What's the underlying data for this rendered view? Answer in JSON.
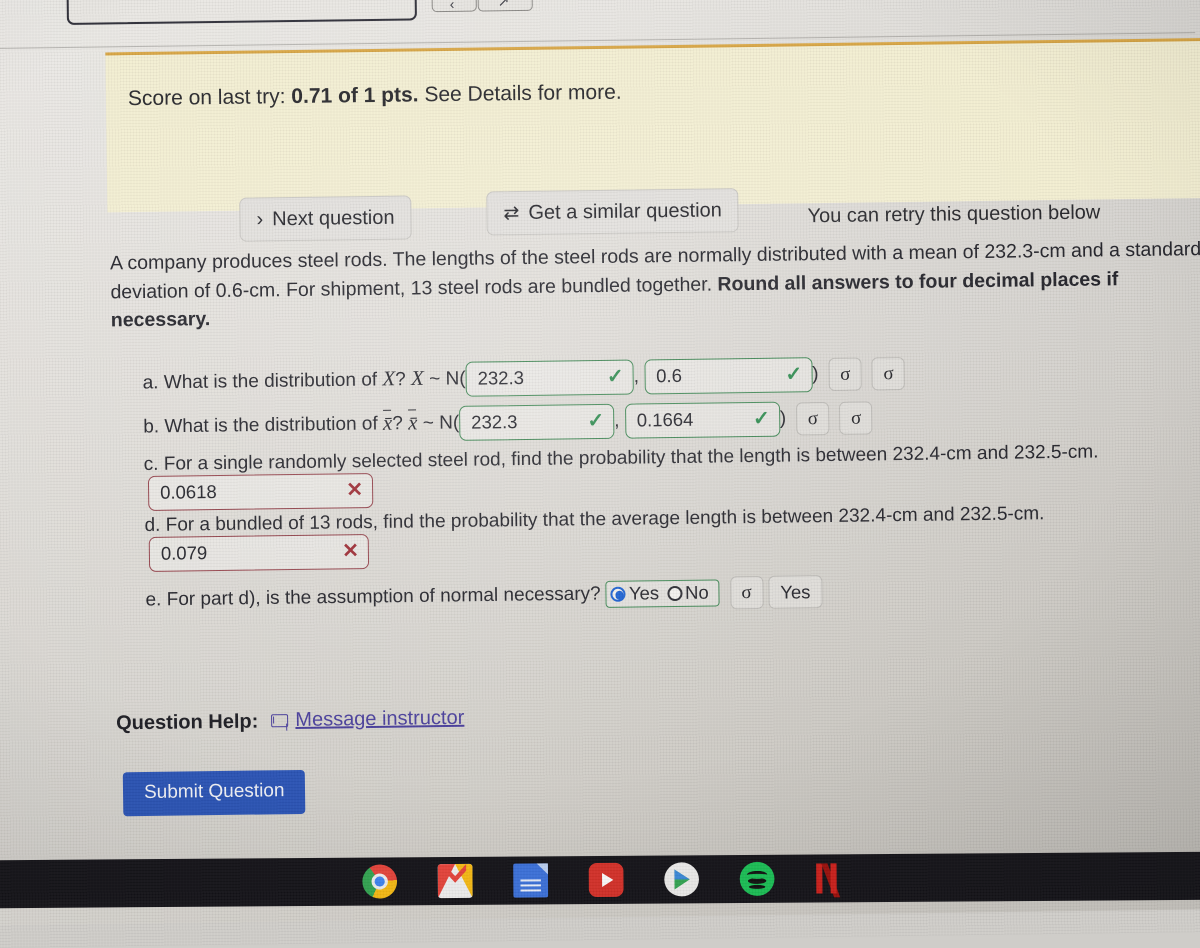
{
  "browser_chrome": {
    "tab_placeholder": "",
    "button_a_glyph": "‹",
    "button_b_glyph": "↗"
  },
  "alert": {
    "score_prefix": "Score on last try:",
    "score_value": "0.71 of 1 pts.",
    "score_suffix": "See Details for more.",
    "next_question_label": "Next question",
    "next_question_icon": "chevron-right-icon",
    "similar_question_label": "Get a similar question",
    "similar_question_icon": "refresh-swap-icon",
    "retry_note": "You can retry this question below",
    "background_color": "#f3eed2",
    "border_color": "#d8a544"
  },
  "question": {
    "prompt_part1": "A company produces steel rods. The lengths of the steel rods are normally distributed with a mean of 232.3-cm and a standard deviation of 0.6-cm. For shipment, 13 steel rods are bundled together. ",
    "prompt_bold": "Round all answers to four decimal places if necessary.",
    "mean": "232.3",
    "std_dev": "0.6",
    "bundle_size": "13",
    "parts": [
      {
        "letter": "a.",
        "text_before": "What is the distribution of",
        "variable": "X",
        "question_mark": "?",
        "dist_var": "X",
        "tilde": "~",
        "dist_open": "N(",
        "field1_value": "232.3",
        "field1_state": "correct",
        "field1_mark": "✓",
        "separator": ",",
        "field2_value": "0.6",
        "field2_state": "correct",
        "field2_mark": "✓",
        "dist_close": ")",
        "sigma_buttons": [
          "σ",
          "σ"
        ]
      },
      {
        "letter": "b.",
        "text_before": "What is the distribution of",
        "variable": "x̄",
        "question_mark": "?",
        "dist_var": "x̄",
        "tilde": "~",
        "dist_open": "N(",
        "field1_value": "232.3",
        "field1_state": "correct",
        "field1_mark": "✓",
        "separator": ",",
        "field2_value": "0.1664",
        "field2_state": "correct",
        "field2_mark": "✓",
        "dist_close": ")",
        "sigma_buttons": [
          "σ",
          "σ"
        ]
      },
      {
        "letter": "c.",
        "text": "For a single randomly selected steel rod, find the probability that the length is between 232.4-cm and 232.5-cm.",
        "field_value": "0.0618",
        "field_state": "incorrect",
        "field_mark": "✕"
      },
      {
        "letter": "d.",
        "text": "For a bundled of 13 rods, find the probability that the average length is between 232.4-cm and 232.5-cm.",
        "field_value": "0.079",
        "field_state": "incorrect",
        "field_mark": "✕"
      },
      {
        "letter": "e.",
        "text": "For part d), is the assumption of normal necessary?",
        "options": [
          "Yes",
          "No"
        ],
        "selected_option": "Yes",
        "sigma_button": "σ",
        "final_answer": "Yes"
      }
    ]
  },
  "footer": {
    "help_label": "Question Help:",
    "message_instructor_label": "Message instructor",
    "message_instructor_icon": "envelope-icon",
    "submit_label": "Submit Question",
    "submit_color": "#2b54b5"
  },
  "taskbar": {
    "icons": [
      "chrome-icon",
      "gmail-icon",
      "google-docs-icon",
      "youtube-icon",
      "google-play-icon",
      "spotify-icon",
      "netflix-icon"
    ],
    "background_color": "#151419"
  }
}
